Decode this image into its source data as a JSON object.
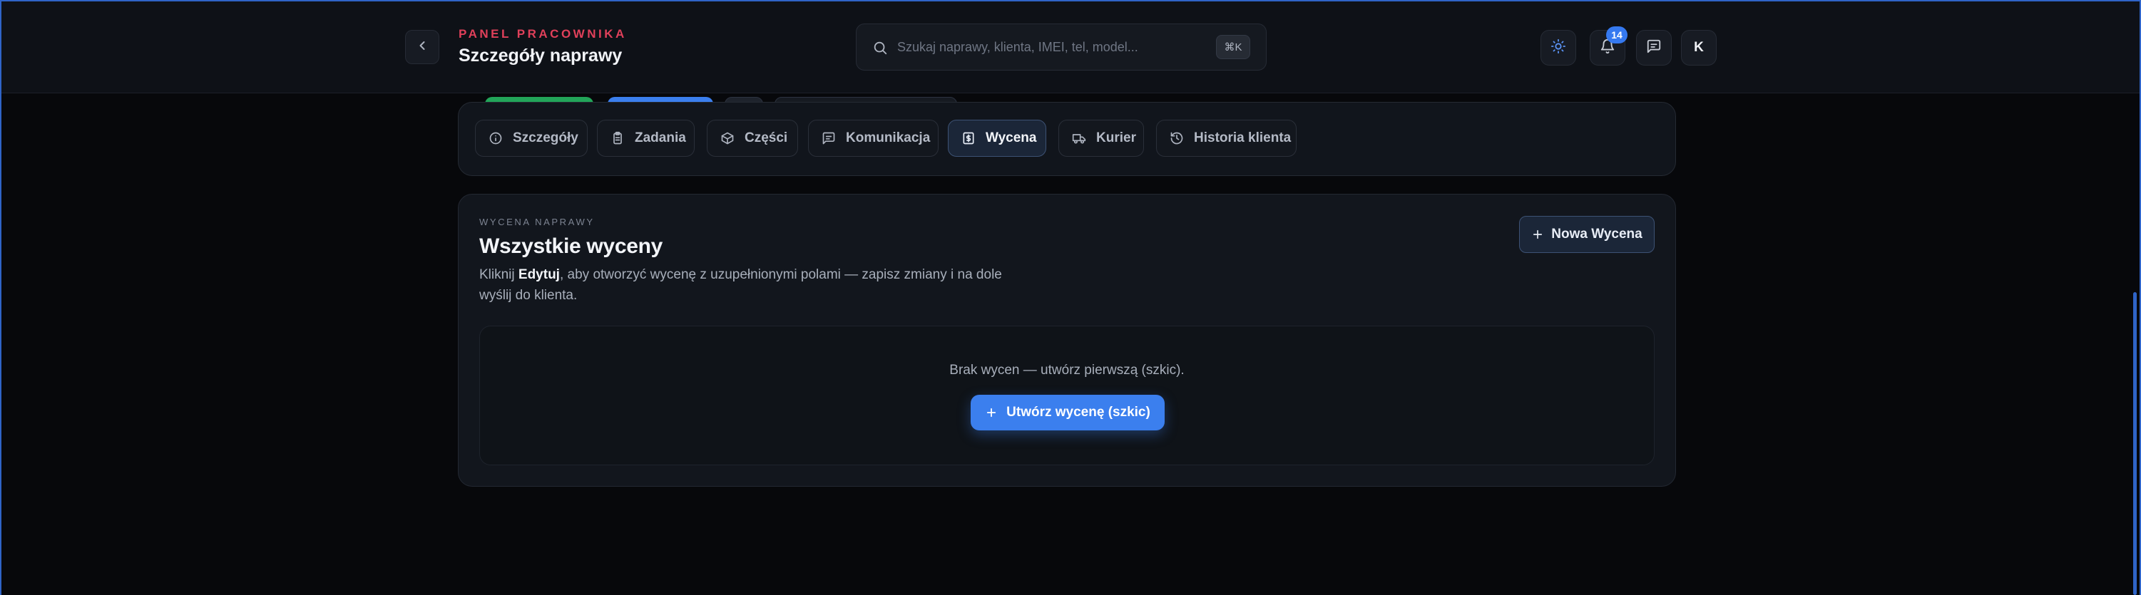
{
  "header": {
    "eyebrow": "PANEL PRACOWNIKA",
    "title": "Szczegóły naprawy",
    "back_icon": "chevron-left-icon",
    "search": {
      "placeholder": "Szukaj naprawy, klienta, IMEI, tel, model...",
      "shortcut": "⌘K"
    },
    "actions": {
      "theme_icon": "sun-icon",
      "notifications_icon": "bell-icon",
      "notification_count": "14",
      "messages_icon": "message-square-icon",
      "avatar_initial": "K"
    }
  },
  "tabs": [
    {
      "label": "Szczegóły",
      "icon": "info-icon"
    },
    {
      "label": "Zadania",
      "icon": "clipboard-icon"
    },
    {
      "label": "Części",
      "icon": "package-icon"
    },
    {
      "label": "Komunikacja",
      "icon": "message-icon"
    },
    {
      "label": "Wycena",
      "icon": "dollar-icon",
      "active": true
    },
    {
      "label": "Kurier",
      "icon": "truck-icon"
    },
    {
      "label": "Historia klienta",
      "icon": "history-icon"
    }
  ],
  "quote_card": {
    "eyebrow": "WYCENA NAPRAWY",
    "title": "Wszystkie wyceny",
    "desc_before": "Kliknij ",
    "desc_bold": "Edytuj",
    "desc_after": ", aby otworzyć wycenę z uzupełnionymi polami — zapisz zmiany i na dole wyślij do klienta.",
    "new_button": "Nowa Wycena",
    "empty_text": "Brak wycen — utwórz pierwszą (szkic).",
    "create_button": "Utwórz wycenę (szkic)"
  },
  "colors": {
    "accent": "#3b7fee",
    "eyebrow_red": "#e0405a",
    "background": "#07080b",
    "header": "#0e1117"
  }
}
